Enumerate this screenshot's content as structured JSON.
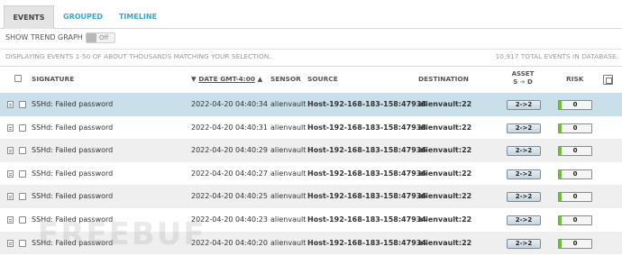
{
  "tabs": [
    {
      "label": "EVENTS",
      "active": true
    },
    {
      "label": "GROUPED",
      "active": false
    },
    {
      "label": "TIMELINE",
      "active": false
    }
  ],
  "trend": {
    "label": "SHOW TREND GRAPH",
    "state": "Off"
  },
  "info": {
    "displaying": "DISPLAYING EVENTS 1-50 OF ABOUT THOUSANDS MATCHING YOUR SELECTION.",
    "total": "10,917 TOTAL EVENTS IN DATABASE."
  },
  "columns": {
    "signature": "SIGNATURE",
    "date": "DATE GMT-4:00",
    "sensor": "SENSOR",
    "source": "SOURCE",
    "destination": "DESTINATION",
    "asset_top": "ASSET",
    "asset_s": "S",
    "asset_d": "D",
    "risk": "RISK"
  },
  "colors": {
    "accent": "#3aa7d6",
    "selected_row": "#c9dfe9",
    "zebra_row": "#efefef",
    "risk_fill": "#6fbf3a"
  },
  "rows": [
    {
      "signature": "SSHd: Failed password",
      "date": "2022-04-20 04:40:34",
      "sensor": "alienvault",
      "source": "Host-192-168-183-158:47938",
      "destination": "alienvault:22",
      "asset": "2->2",
      "risk": "0",
      "selected": true
    },
    {
      "signature": "SSHd: Failed password",
      "date": "2022-04-20 04:40:31",
      "sensor": "alienvault",
      "source": "Host-192-168-183-158:47938",
      "destination": "alienvault:22",
      "asset": "2->2",
      "risk": "0",
      "selected": false
    },
    {
      "signature": "SSHd: Failed password",
      "date": "2022-04-20 04:40:29",
      "sensor": "alienvault",
      "source": "Host-192-168-183-158:47936",
      "destination": "alienvault:22",
      "asset": "2->2",
      "risk": "0",
      "selected": false
    },
    {
      "signature": "SSHd: Failed password",
      "date": "2022-04-20 04:40:27",
      "sensor": "alienvault",
      "source": "Host-192-168-183-158:47936",
      "destination": "alienvault:22",
      "asset": "2->2",
      "risk": "0",
      "selected": false
    },
    {
      "signature": "SSHd: Failed password",
      "date": "2022-04-20 04:40:25",
      "sensor": "alienvault",
      "source": "Host-192-168-183-158:47936",
      "destination": "alienvault:22",
      "asset": "2->2",
      "risk": "0",
      "selected": false
    },
    {
      "signature": "SSHd: Failed password",
      "date": "2022-04-20 04:40:23",
      "sensor": "alienvault",
      "source": "Host-192-168-183-158:47934",
      "destination": "alienvault:22",
      "asset": "2->2",
      "risk": "0",
      "selected": false
    },
    {
      "signature": "SSHd: Failed password",
      "date": "2022-04-20 04:40:20",
      "sensor": "alienvault",
      "source": "Host-192-168-183-158:47934",
      "destination": "alienvault:22",
      "asset": "2->2",
      "risk": "0",
      "selected": false
    }
  ],
  "watermark": "FREEBUF"
}
